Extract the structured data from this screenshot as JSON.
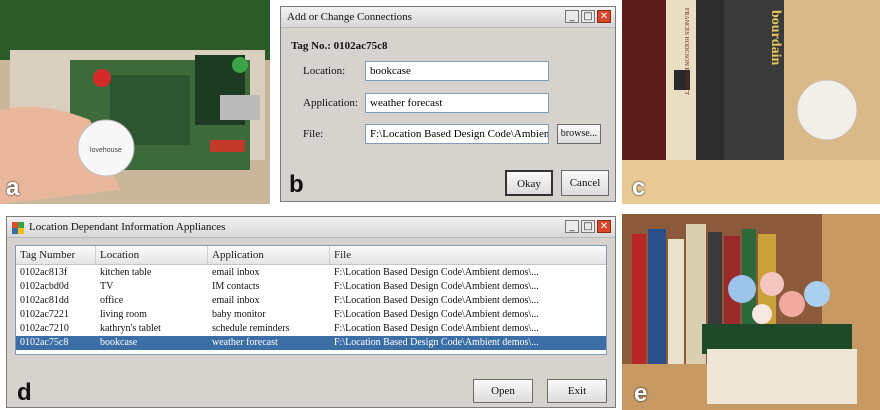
{
  "panels": {
    "a": {
      "label": "a",
      "tag_text": "lovehouse"
    },
    "b": {
      "label": "b"
    },
    "c": {
      "label": "c",
      "book_title": "bourdain",
      "book_author": "FRANCES HODGSON BURNETT"
    },
    "d": {
      "label": "d"
    },
    "e": {
      "label": "e"
    }
  },
  "dialog": {
    "title": "Add or Change Connections",
    "tag_no": "Tag No.: 0102ac75c8",
    "location_label": "Location:",
    "location_value": "bookcase",
    "application_label": "Application:",
    "application_value": "weather forecast",
    "file_label": "File:",
    "file_value": "F:\\Location Based Design Code\\Ambient",
    "browse_label": "browse...",
    "okay_label": "Okay",
    "cancel_label": "Cancel",
    "min_glyph": "_",
    "max_glyph": "□",
    "close_glyph": "✕"
  },
  "app": {
    "title": "Location Dependant Information Appliances",
    "columns": [
      "Tag Number",
      "Location",
      "Application",
      "File"
    ],
    "rows": [
      {
        "tag": "0102ac813f",
        "location": "kitchen table",
        "application": "email inbox",
        "file": "F:\\Location Based Design Code\\Ambient demos\\..."
      },
      {
        "tag": "0102acbd0d",
        "location": "TV",
        "application": "IM contacts",
        "file": "F:\\Location Based Design Code\\Ambient demos\\..."
      },
      {
        "tag": "0102ac81dd",
        "location": "office",
        "application": "email inbox",
        "file": "F:\\Location Based Design Code\\Ambient demos\\..."
      },
      {
        "tag": "0102ac7221",
        "location": "living room",
        "application": "baby monitor",
        "file": "F:\\Location Based Design Code\\Ambient demos\\..."
      },
      {
        "tag": "0102ac7210",
        "location": "kathryn's tablet",
        "application": "schedule reminders",
        "file": "F:\\Location Based Design Code\\Ambient demos\\..."
      },
      {
        "tag": "0102ac75c8",
        "location": "bookcase",
        "application": "weather forecast",
        "file": "F:\\Location Based Design Code\\Ambient demos\\..."
      }
    ],
    "selected_row": 5,
    "open_label": "Open",
    "exit_label": "Exit",
    "min_glyph": "_",
    "max_glyph": "□",
    "close_glyph": "✕"
  },
  "colors": {
    "selection": "#3a6ea5",
    "close_button": "#d9472b",
    "window_face": "#d6d3ce"
  }
}
